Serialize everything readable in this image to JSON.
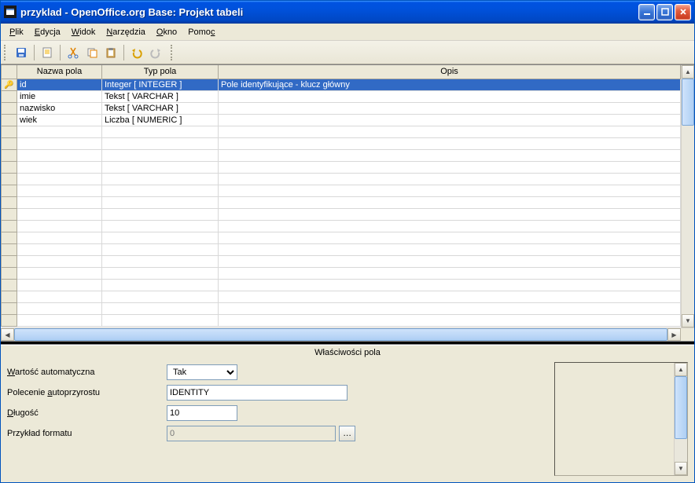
{
  "window": {
    "title": "przyklad - OpenOffice.org Base: Projekt tabeli"
  },
  "menu": {
    "file": "Plik",
    "edit": "Edycja",
    "view": "Widok",
    "tools": "Narzędzia",
    "window": "Okno",
    "help": "Pomoc"
  },
  "columns": {
    "name": "Nazwa pola",
    "type": "Typ pola",
    "desc": "Opis"
  },
  "rows": [
    {
      "pk": true,
      "name": "id",
      "type": "Integer [ INTEGER ]",
      "desc": "Pole identyfikujące - klucz główny",
      "selected": true
    },
    {
      "pk": false,
      "name": "imie",
      "type": "Tekst [ VARCHAR ]",
      "desc": "",
      "selected": false
    },
    {
      "pk": false,
      "name": "nazwisko",
      "type": "Tekst [ VARCHAR ]",
      "desc": "",
      "selected": false
    },
    {
      "pk": false,
      "name": "wiek",
      "type": "Liczba [ NUMERIC ]",
      "desc": "",
      "selected": false
    }
  ],
  "props": {
    "title": "Właściwości pola",
    "auto_value_label": "Wartość automatyczna",
    "auto_value": "Tak",
    "autoinc_label": "Polecenie autoprzyrostu",
    "autoinc": "IDENTITY",
    "length_label": "Długość",
    "length": "10",
    "format_label": "Przykład formatu",
    "format": "0"
  }
}
